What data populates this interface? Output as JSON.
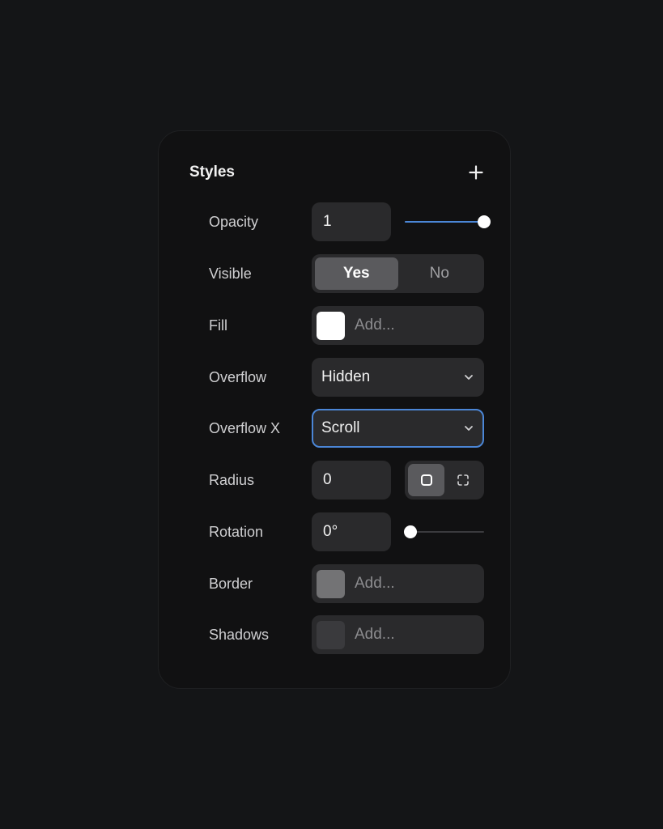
{
  "panel": {
    "title": "Styles",
    "add_icon": "plus-icon"
  },
  "opacity": {
    "label": "Opacity",
    "value": "1",
    "slider_level": 1.0,
    "accent": "#4b86d6"
  },
  "visible": {
    "label": "Visible",
    "options": [
      "Yes",
      "No"
    ],
    "selected": "Yes"
  },
  "fill": {
    "label": "Fill",
    "placeholder": "Add...",
    "swatch_color": "#ffffff"
  },
  "overflow": {
    "label": "Overflow",
    "value": "Hidden",
    "icon": "chevron-down-icon"
  },
  "overflow_x": {
    "label": "Overflow X",
    "value": "Scroll",
    "icon": "chevron-down-icon",
    "focus_color": "#4b86d6"
  },
  "radius": {
    "label": "Radius",
    "value": "0",
    "modes": [
      "uniform-corners-icon",
      "individual-corners-icon"
    ],
    "selected_mode": "uniform-corners-icon"
  },
  "rotation": {
    "label": "Rotation",
    "value": "0°",
    "slider_level": 0.0
  },
  "border": {
    "label": "Border",
    "placeholder": "Add...",
    "swatch_color": "#737375"
  },
  "shadows": {
    "label": "Shadows",
    "placeholder": "Add...",
    "swatch_color": "#3a3a3d"
  }
}
